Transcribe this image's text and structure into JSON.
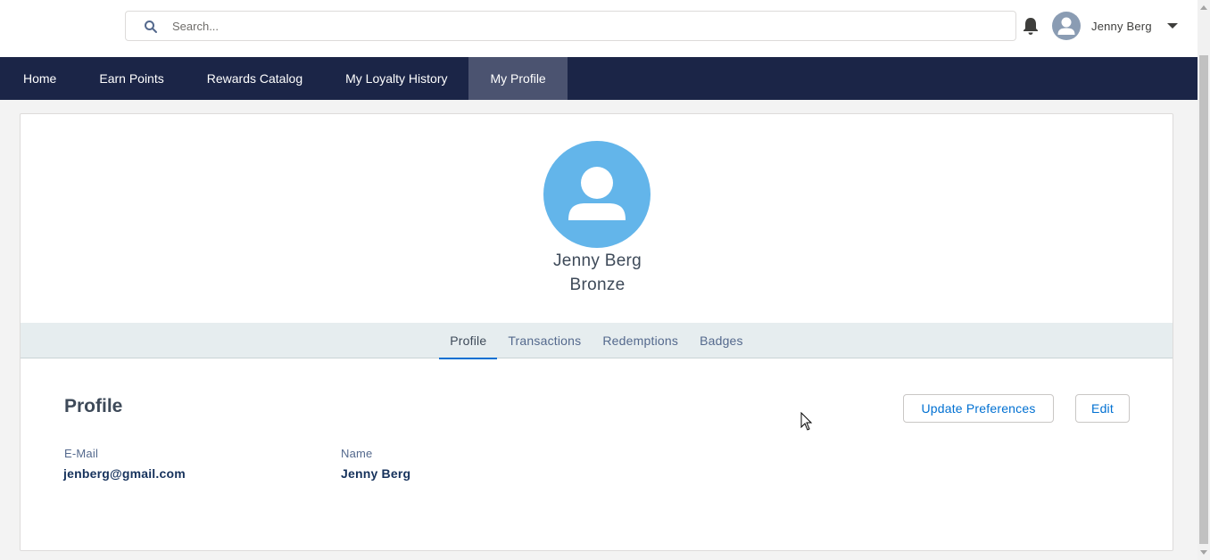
{
  "header": {
    "search_placeholder": "Search...",
    "user_name": "Jenny Berg"
  },
  "nav": {
    "items": [
      {
        "label": "Home"
      },
      {
        "label": "Earn Points"
      },
      {
        "label": "Rewards Catalog"
      },
      {
        "label": "My Loyalty History"
      },
      {
        "label": "My Profile",
        "active": true
      }
    ]
  },
  "profile": {
    "name": "Jenny Berg",
    "tier": "Bronze"
  },
  "tabs": [
    {
      "label": "Profile",
      "active": true
    },
    {
      "label": "Transactions"
    },
    {
      "label": "Redemptions"
    },
    {
      "label": "Badges"
    }
  ],
  "section": {
    "title": "Profile",
    "update_button": "Update Preferences",
    "edit_button": "Edit"
  },
  "fields": {
    "email_label": "E-Mail",
    "email_value": "jenberg@gmail.com",
    "name_label": "Name",
    "name_value": "Jenny Berg"
  },
  "colors": {
    "nav_bg": "#1b2547",
    "nav_active_bg": "#4b5370",
    "avatar_bg": "#63b5ea",
    "link_blue": "#0070d2",
    "tabs_bg": "#e6edef"
  }
}
